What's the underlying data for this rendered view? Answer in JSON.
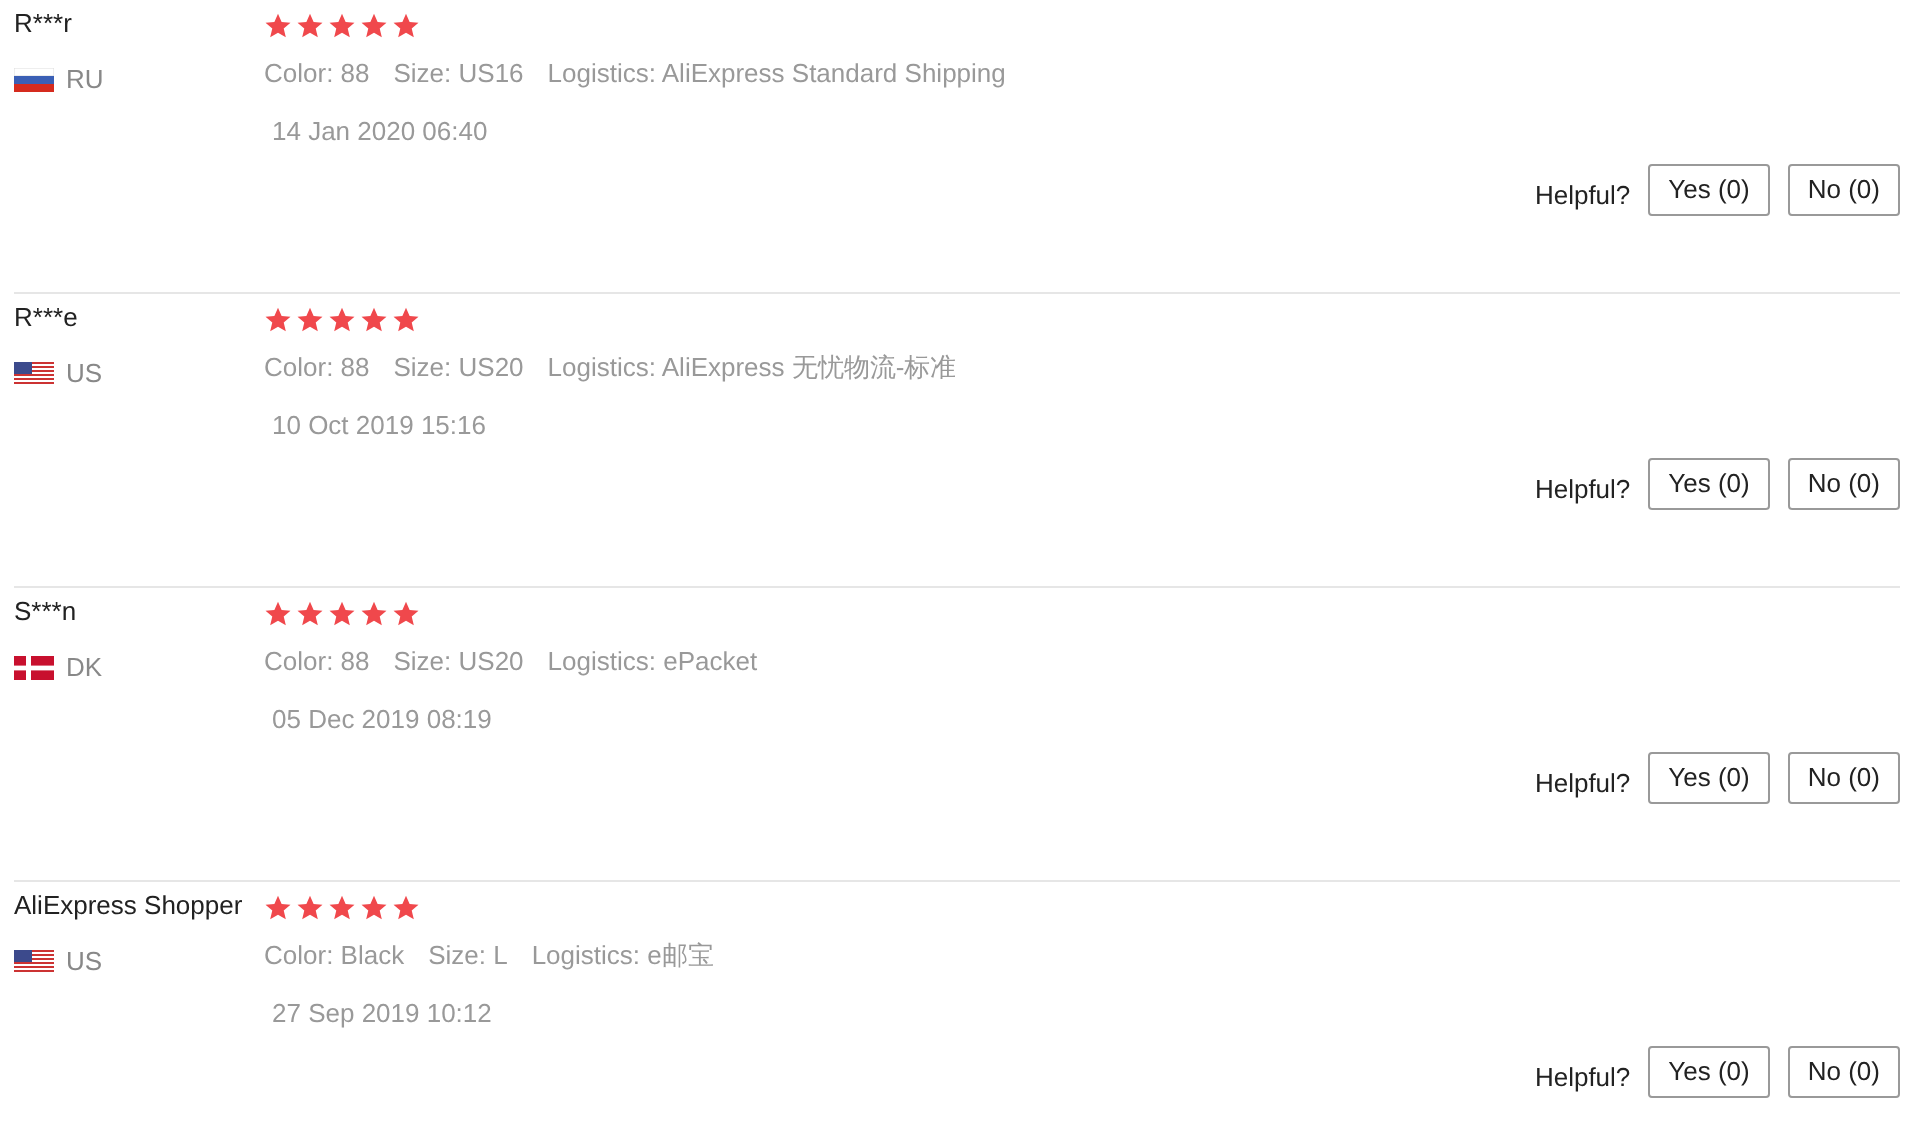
{
  "reviews": [
    {
      "name": "R***r",
      "country": "RU",
      "kind": "ru",
      "stars": 5,
      "details": [
        "Color: 88",
        "Size: US16",
        "Logistics: AliExpress Standard Shipping"
      ],
      "date": "14 Jan 2020 06:40",
      "helpful_label": "Helpful?",
      "yes": "Yes (0)",
      "no": "No (0)"
    },
    {
      "name": "R***e",
      "country": "US",
      "kind": "us",
      "stars": 5,
      "details": [
        "Color: 88",
        "Size: US20",
        "Logistics: AliExpress 无忧物流-标准"
      ],
      "date": "10 Oct 2019 15:16",
      "helpful_label": "Helpful?",
      "yes": "Yes (0)",
      "no": "No (0)"
    },
    {
      "name": "S***n",
      "country": "DK",
      "kind": "dk",
      "stars": 5,
      "details": [
        "Color: 88",
        "Size: US20",
        "Logistics: ePacket"
      ],
      "date": "05 Dec 2019 08:19",
      "helpful_label": "Helpful?",
      "yes": "Yes (0)",
      "no": "No (0)"
    },
    {
      "name": "AliExpress Shopper",
      "country": "US",
      "kind": "us",
      "stars": 5,
      "details": [
        "Color: Black",
        "Size: L",
        "Logistics: e邮宝"
      ],
      "date": "27 Sep 2019 10:12",
      "helpful_label": "Helpful?",
      "yes": "Yes (0)",
      "no": "No (0)"
    }
  ]
}
